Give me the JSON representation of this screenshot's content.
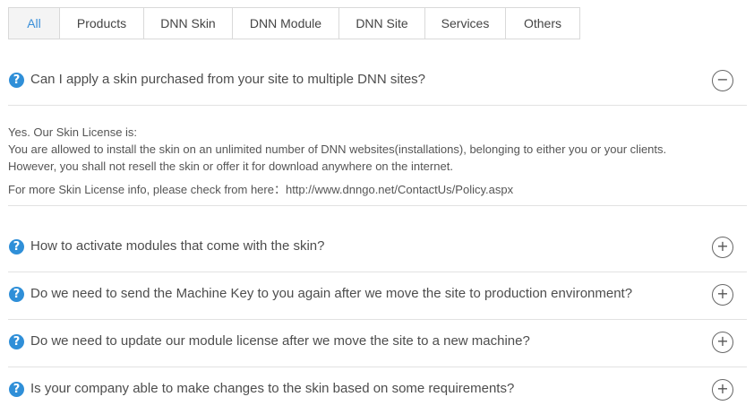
{
  "tabs": [
    {
      "label": "All",
      "active": true
    },
    {
      "label": "Products"
    },
    {
      "label": "DNN Skin"
    },
    {
      "label": "DNN Module"
    },
    {
      "label": "DNN Site"
    },
    {
      "label": "Services"
    },
    {
      "label": "Others"
    }
  ],
  "faqs": [
    {
      "question": "Can I apply a skin purchased from your site to multiple DNN sites?",
      "expanded": true,
      "toggle_symbol": "−",
      "answer_lines": [
        "Yes. Our Skin License is:",
        "You are allowed to install the skin on an unlimited number of DNN websites(installations), belonging to either you or your clients.",
        "However, you shall not resell the skin or offer it for download anywhere on the internet."
      ],
      "answer_more": "For more Skin License info, please check from here：http://www.dnngo.net/ContactUs/Policy.aspx"
    },
    {
      "question": "How to activate modules that come with the skin?",
      "toggle_symbol": "+"
    },
    {
      "question": "Do we need to send the Machine Key to you again after we move the site to production environment?",
      "toggle_symbol": "+"
    },
    {
      "question": "Do we need to update our module license after we move the site to a new machine?",
      "toggle_symbol": "+"
    },
    {
      "question": "Is your company able to make changes to the skin based on some requirements?",
      "toggle_symbol": "+"
    }
  ],
  "icons": {
    "question": "question-circle-icon",
    "expanded": "minus-circle-icon",
    "collapsed": "plus-circle-icon",
    "question_glyph": "?"
  },
  "colors": {
    "accent": "#3a8fd9",
    "question_icon": "#2f8fd8",
    "border": "#e2e2e2"
  }
}
